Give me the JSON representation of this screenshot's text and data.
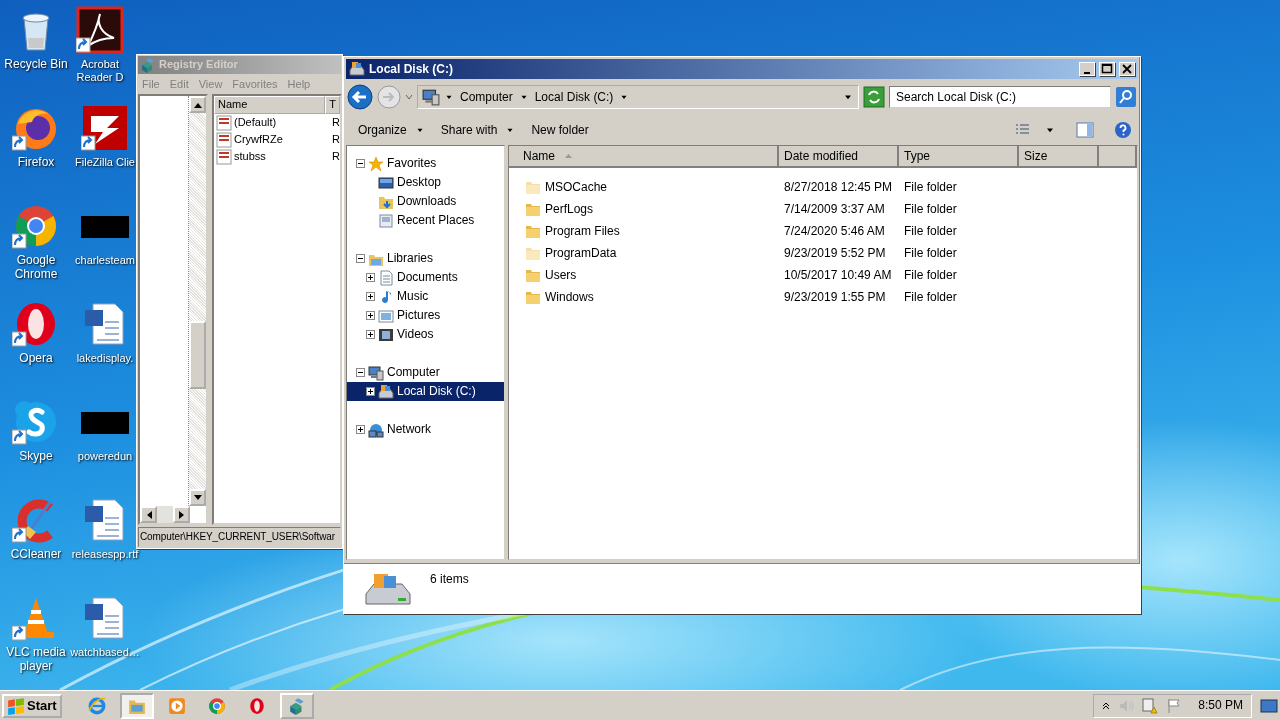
{
  "desktop_icons": [
    {
      "label": "Recycle Bin",
      "kind": "recycle",
      "shortcut": false
    },
    {
      "label": "Firefox",
      "kind": "firefox",
      "shortcut": true
    },
    {
      "label": "Google Chrome",
      "kind": "chrome",
      "shortcut": true
    },
    {
      "label": "Opera",
      "kind": "opera",
      "shortcut": true
    },
    {
      "label": "Skype",
      "kind": "skype",
      "shortcut": true
    },
    {
      "label": "CCleaner",
      "kind": "ccleaner",
      "shortcut": true
    },
    {
      "label": "VLC media player",
      "kind": "vlc",
      "shortcut": true
    },
    {
      "label": "Acrobat Reader D",
      "kind": "acrobat",
      "shortcut": true
    },
    {
      "label": "FileZilla Clie",
      "kind": "filezilla",
      "shortcut": true
    },
    {
      "label": "charlesteam",
      "kind": "blank",
      "shortcut": false
    },
    {
      "label": "lakedisplay.",
      "kind": "document",
      "shortcut": false
    },
    {
      "label": "poweredun",
      "kind": "blank",
      "shortcut": false
    },
    {
      "label": "releasespp.rtf",
      "kind": "document",
      "shortcut": false
    },
    {
      "label": "watchbased…",
      "kind": "document",
      "shortcut": false
    }
  ],
  "registry_editor": {
    "title": "Registry Editor",
    "menu": [
      "File",
      "Edit",
      "View",
      "Favorites",
      "Help"
    ],
    "columns": [
      "Name",
      "T"
    ],
    "values": [
      {
        "name": "(Default)",
        "column_2": "R"
      },
      {
        "name": "CrywfRZe",
        "column_2": "R"
      },
      {
        "name": "stubss",
        "column_2": "R"
      }
    ],
    "status_bar": "Computer\\HKEY_CURRENT_USER\\Softwar"
  },
  "explorer": {
    "title": "Local Disk (C:)",
    "breadcrumb": [
      "Computer",
      "Local Disk (C:)"
    ],
    "search": {
      "placeholder": "Search Local Disk (C:)"
    },
    "toolbar": [
      {
        "label": "Organize",
        "dropdown": true
      },
      {
        "label": "Share with",
        "dropdown": true
      },
      {
        "label": "New folder",
        "dropdown": false
      }
    ],
    "navigation": [
      {
        "label": "Favorites",
        "kind": "star",
        "expanded": true,
        "selected": false,
        "children": [
          {
            "label": "Desktop",
            "kind": "desktop",
            "selected": false
          },
          {
            "label": "Downloads",
            "kind": "downloads",
            "selected": false
          },
          {
            "label": "Recent Places",
            "kind": "recent",
            "selected": false
          }
        ]
      },
      {
        "label": "Libraries",
        "kind": "library",
        "expanded": true,
        "selected": false,
        "children": [
          {
            "label": "Documents",
            "kind": "documents",
            "expanded": false,
            "selected": false
          },
          {
            "label": "Music",
            "kind": "music",
            "expanded": false,
            "selected": false
          },
          {
            "label": "Pictures",
            "kind": "pictures",
            "expanded": false,
            "selected": false
          },
          {
            "label": "Videos",
            "kind": "videos",
            "expanded": false,
            "selected": false
          }
        ]
      },
      {
        "label": "Computer",
        "kind": "computer",
        "expanded": true,
        "selected": false,
        "children": [
          {
            "label": "Local Disk (C:)",
            "kind": "drive",
            "expanded": false,
            "selected": true
          }
        ]
      },
      {
        "label": "Network",
        "kind": "network",
        "expanded": false,
        "selected": false
      }
    ],
    "columns": [
      {
        "label": "Name",
        "sorted": true
      },
      {
        "label": "Date modified",
        "sorted": false
      },
      {
        "label": "Type",
        "sorted": false
      },
      {
        "label": "Size",
        "sorted": false
      }
    ],
    "files": [
      {
        "name": "MSOCache",
        "date_modified": "8/27/2018 12:45 PM",
        "type": "File folder",
        "hidden": true
      },
      {
        "name": "PerfLogs",
        "date_modified": "7/14/2009 3:37 AM",
        "type": "File folder",
        "hidden": false
      },
      {
        "name": "Program Files",
        "date_modified": "7/24/2020 5:46 AM",
        "type": "File folder",
        "hidden": false
      },
      {
        "name": "ProgramData",
        "date_modified": "9/23/2019 5:52 PM",
        "type": "File folder",
        "hidden": true
      },
      {
        "name": "Users",
        "date_modified": "10/5/2017 10:49 AM",
        "type": "File folder",
        "hidden": false
      },
      {
        "name": "Windows",
        "date_modified": "9/23/2019 1:55 PM",
        "type": "File folder",
        "hidden": false
      }
    ],
    "status": "6 items"
  },
  "taskbar": {
    "start": "Start",
    "buttons": [
      {
        "kind": "ie",
        "task": false,
        "pressed": false
      },
      {
        "kind": "explorer",
        "task": true,
        "pressed": true
      },
      {
        "kind": "media",
        "task": false,
        "pressed": false
      },
      {
        "kind": "chrome",
        "task": false,
        "pressed": false
      },
      {
        "kind": "opera",
        "task": false,
        "pressed": false
      },
      {
        "kind": "regedit",
        "task": true,
        "pressed": false
      }
    ],
    "clock": "8:50 PM"
  }
}
